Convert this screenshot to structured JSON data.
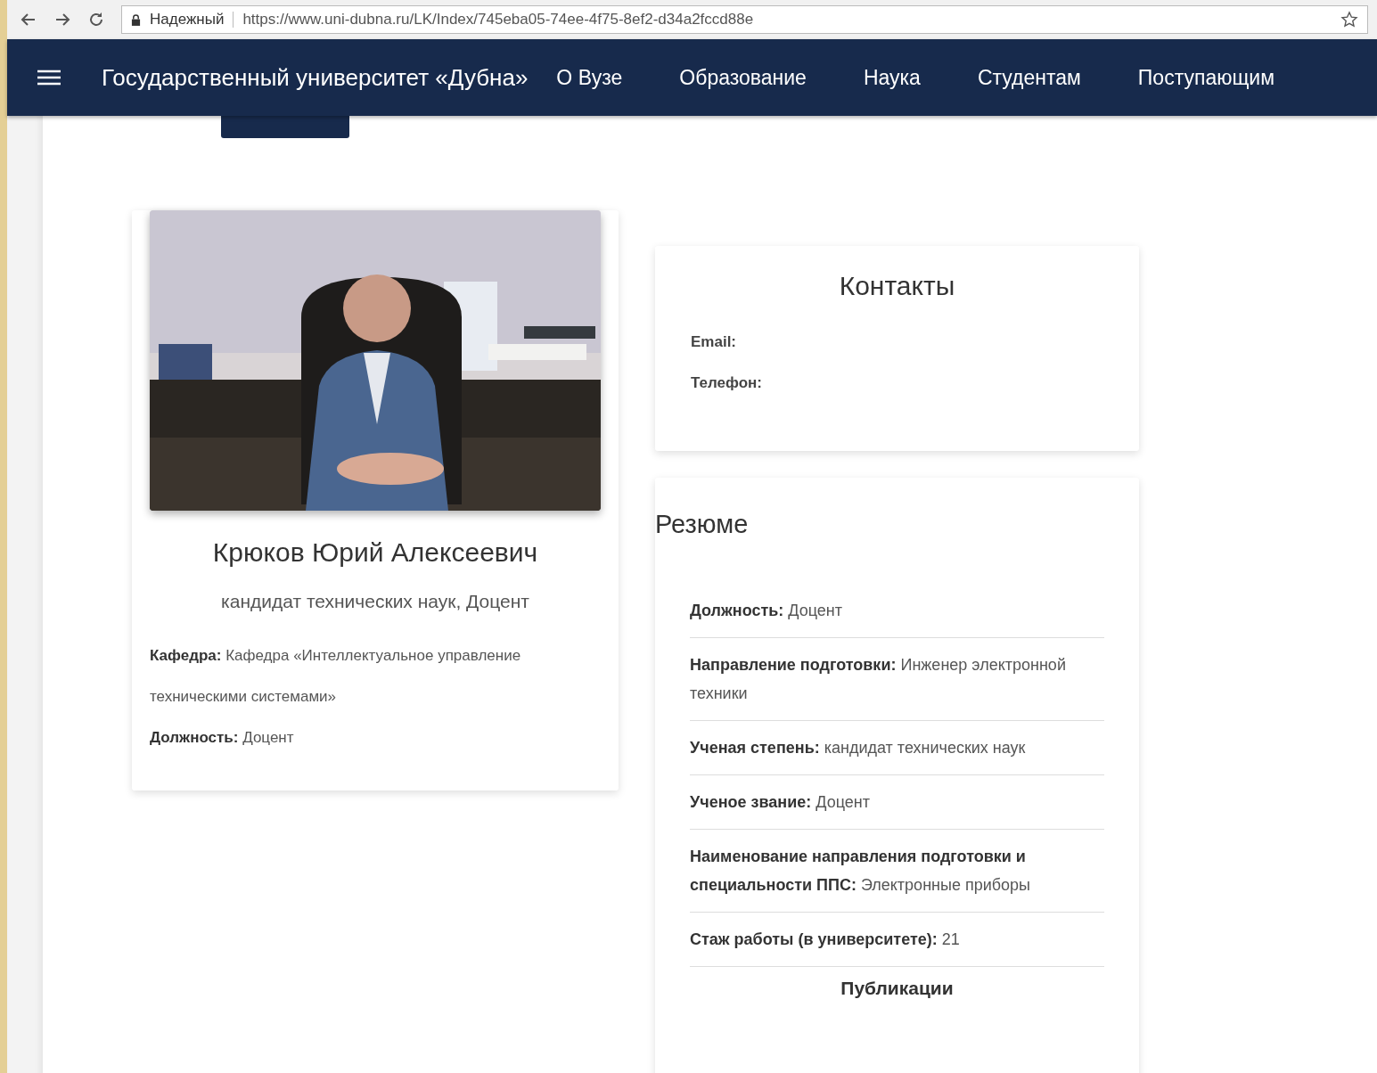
{
  "browser": {
    "security_label": "Надежный",
    "url": "https://www.uni-dubna.ru/LK/Index/745eba05-74ee-4f75-8ef2-d34a2fccd88e"
  },
  "navbar": {
    "title": "Государственный университет «Дубна»",
    "links": [
      "О Вузе",
      "Образование",
      "Наука",
      "Студентам",
      "Поступающим"
    ]
  },
  "tabs": [
    {
      "selected": true
    }
  ],
  "profile": {
    "name": "Крюков Юрий Алексеевич",
    "subtitle": "кандидат технических наук, Доцент",
    "fields": [
      {
        "label": "Кафедра:",
        "value": "Кафедра «Интеллектуальное управление техническими системами»"
      },
      {
        "label": "Должность:",
        "value": "Доцент"
      }
    ]
  },
  "contacts": {
    "title": "Контакты",
    "fields": [
      {
        "label": "Email:"
      },
      {
        "label": "Телефон:"
      }
    ]
  },
  "resume": {
    "title": "Резюме",
    "fields": [
      {
        "label": "Должность:",
        "value": "Доцент"
      },
      {
        "label": "Направление подготовки:",
        "value": "Инженер электронной техники"
      },
      {
        "label": "Ученая степень:",
        "value": "кандидат технических наук"
      },
      {
        "label": "Ученое звание:",
        "value": "Доцент"
      },
      {
        "label": "Наименование направления подготовки и специальности ППС:",
        "value": "Электронные приборы"
      },
      {
        "label": "Стаж работы (в университете):",
        "value": "21"
      }
    ],
    "publications_title": "Публикации"
  }
}
